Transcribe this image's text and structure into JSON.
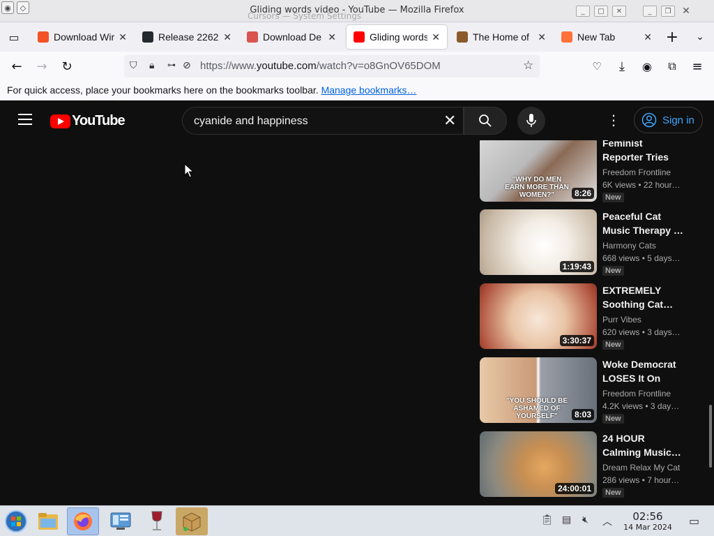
{
  "window": {
    "title": "Gliding words video - YouTube — Mozilla Firefox",
    "background_notice": "Cursors — System Settings",
    "controls": [
      "_",
      "□",
      "✕"
    ]
  },
  "tabs": [
    {
      "label": "Download Wir",
      "favicon_color": "#f35325",
      "icon": "windows-logo-icon",
      "active": false
    },
    {
      "label": "Release 2262",
      "favicon_color": "#24292f",
      "icon": "github-icon",
      "active": false
    },
    {
      "label": "Download De",
      "favicon_color": "#d9534f",
      "icon": "download-site-icon",
      "active": false
    },
    {
      "label": "Gliding words",
      "favicon_color": "#ff0000",
      "icon": "youtube-icon",
      "active": true
    },
    {
      "label": "The Home of",
      "favicon_color": "#8a5a2b",
      "icon": "site-icon",
      "active": false
    },
    {
      "label": "New Tab",
      "favicon_color": "#ff7139",
      "icon": "firefox-icon",
      "active": false
    }
  ],
  "navbar": {
    "url_prefix": "https://www.",
    "url_domain": "youtube.com",
    "url_path": "/watch?v=o8GnOV65DOM"
  },
  "bookmarks": {
    "text": "For quick access, place your bookmarks here on the bookmarks toolbar.",
    "link": "Manage bookmarks…"
  },
  "youtube": {
    "logo_text": "YouTube",
    "search_value": "cyanide and happiness",
    "signin_label": "Sign in",
    "brand_color": "#ff0000",
    "link_color": "#3ea6ff"
  },
  "recommendations": [
    {
      "title": "Feminist Reporter Tries T…",
      "channel": "Freedom Frontline",
      "meta": "6K views • 22 hour…",
      "badge": "New",
      "duration": "8:26",
      "thumb_text": "\"WHY DO MEN EARN MORE THAN WOMEN?\""
    },
    {
      "title": "Peaceful Cat Music Therapy …",
      "channel": "Harmony Cats",
      "meta": "668 views • 5 days…",
      "badge": "New",
      "duration": "1:19:43"
    },
    {
      "title": "EXTREMELY Soothing Cat…",
      "channel": "Purr Vibes",
      "meta": "620 views • 3 days…",
      "badge": "New",
      "duration": "3:30:37"
    },
    {
      "title": "Woke Democrat LOSES It On LIV…",
      "channel": "Freedom Frontline",
      "meta": "4.2K views • 3 day…",
      "badge": "New",
      "duration": "8:03",
      "thumb_text": "\"YOU SHOULD BE ASHAMED OF YOURSELF\""
    },
    {
      "title": "24 HOUR Calming Music…",
      "channel": "Dream Relax My Cat",
      "meta": "286 views • 7 hour…",
      "badge": "New",
      "duration": "24:00:01"
    }
  ],
  "taskbar": {
    "apps": [
      "start-menu-icon",
      "file-manager-icon",
      "firefox-icon",
      "system-settings-icon",
      "wine-icon",
      "package-installer-icon"
    ],
    "time": "02:56",
    "date": "14 Mar 2024"
  }
}
